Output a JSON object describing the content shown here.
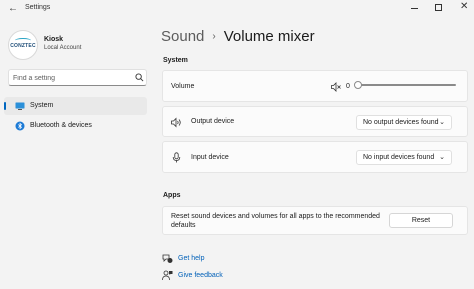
{
  "window": {
    "title": "Settings"
  },
  "profile": {
    "name": "Kiosk",
    "account": "Local Account",
    "logo_text": "CONZTEC"
  },
  "search": {
    "placeholder": "Find a setting"
  },
  "nav": {
    "items": [
      {
        "label": "System"
      },
      {
        "label": "Bluetooth & devices"
      }
    ]
  },
  "breadcrumb": {
    "parent": "Sound",
    "separator": "›",
    "current": "Volume mixer"
  },
  "system": {
    "heading": "System",
    "volume": {
      "label": "Volume",
      "value": "0"
    },
    "output": {
      "label": "Output device",
      "selected": "No output devices found"
    },
    "input": {
      "label": "Input device",
      "selected": "No input devices found"
    }
  },
  "apps": {
    "heading": "Apps",
    "reset_text": "Reset sound devices and volumes for all apps to the recommended defaults",
    "reset_button": "Reset"
  },
  "links": {
    "help": "Get help",
    "feedback": "Give feedback"
  },
  "colors": {
    "accent": "#0067c0",
    "link": "#0060b8",
    "background": "#f3f3f3"
  }
}
